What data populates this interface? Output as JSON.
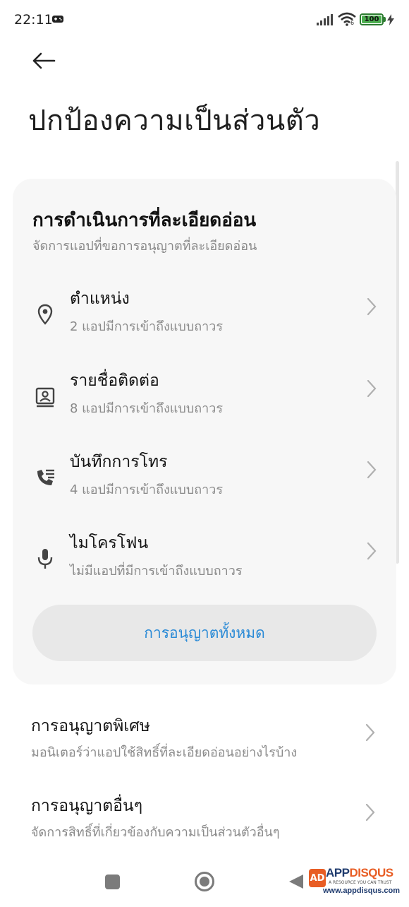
{
  "status_bar": {
    "time": "22:11",
    "battery_level": "100",
    "wifi_badge": "6",
    "icons": [
      "game-controller-icon",
      "signal-icon",
      "wifi-icon",
      "battery-icon",
      "charging-icon"
    ]
  },
  "header": {
    "back_icon": "arrow-left-icon",
    "title": "ปกป้องความเป็นส่วนตัว"
  },
  "sensitive_card": {
    "title": "การดำเนินการที่ละเอียดอ่อน",
    "subtitle": "จัดการแอปที่ขอการอนุญาตที่ละเอียดอ่อน",
    "items": [
      {
        "label": "ตำแหน่ง",
        "desc": "2 แอปมีการเข้าถึงแบบถาวร",
        "icon": "location-pin-icon"
      },
      {
        "label": "รายชื่อติดต่อ",
        "desc": "8 แอปมีการเข้าถึงแบบถาวร",
        "icon": "contacts-icon"
      },
      {
        "label": "บันทึกการโทร",
        "desc": "4 แอปมีการเข้าถึงแบบถาวร",
        "icon": "call-log-icon"
      },
      {
        "label": "ไมโครโฟน",
        "desc": "ไม่มีแอปที่มีการเข้าถึงแบบถาวร",
        "icon": "microphone-icon"
      }
    ],
    "allow_all_label": "การอนุญาตทั้งหมด"
  },
  "settings_rows": [
    {
      "label": "การอนุญาตพิเศษ",
      "desc": "มอนิเตอร์ว่าแอปใช้สิทธิ์ที่ละเอียดอ่อนอย่างไรบ้าง"
    },
    {
      "label": "การอนุญาตอื่นๆ",
      "desc": "จัดการสิทธิ์ที่เกี่ยวข้องกับความเป็นส่วนตัวอื่นๆ"
    }
  ],
  "watermark": {
    "brand_a": "APP",
    "brand_b": "DISQUS",
    "tagline": "A RESOURCE YOU CAN TRUST",
    "url": "www.appdisqus.com"
  },
  "colors": {
    "accent": "#2a8ad6",
    "card_bg": "#f7f7f7",
    "button_bg": "#e8e8e8",
    "battery": "#4caf50"
  }
}
